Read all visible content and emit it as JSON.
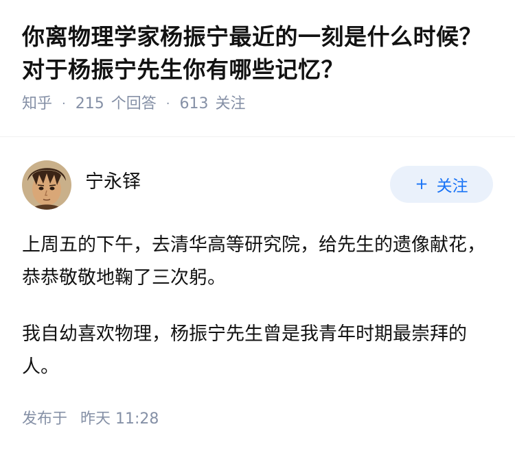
{
  "question": {
    "title": "你离物理学家杨振宁最近的一刻是什么时候？对于杨振宁先生你有哪些记忆？",
    "source": "知乎",
    "separator": "·",
    "answer_count": "215",
    "answer_count_label": "个回答",
    "follower_count": "613",
    "follower_count_label": "关注"
  },
  "answer": {
    "author_name": "宁永铎",
    "follow_icon": "+",
    "follow_label": "关注",
    "paragraphs": [
      "上周五的下午，去清华高等研究院，给先生的遗像献花，恭恭敬敬地鞠了三次躬。",
      "我自幼喜欢物理，杨振宁先生曾是我青年时期最崇拜的人。"
    ],
    "published_label": "发布于",
    "published_time": "昨天 11:28"
  },
  "colors": {
    "accent": "#1772f6",
    "meta_gray": "#8590a6",
    "follow_bg": "#eaf1fb"
  }
}
